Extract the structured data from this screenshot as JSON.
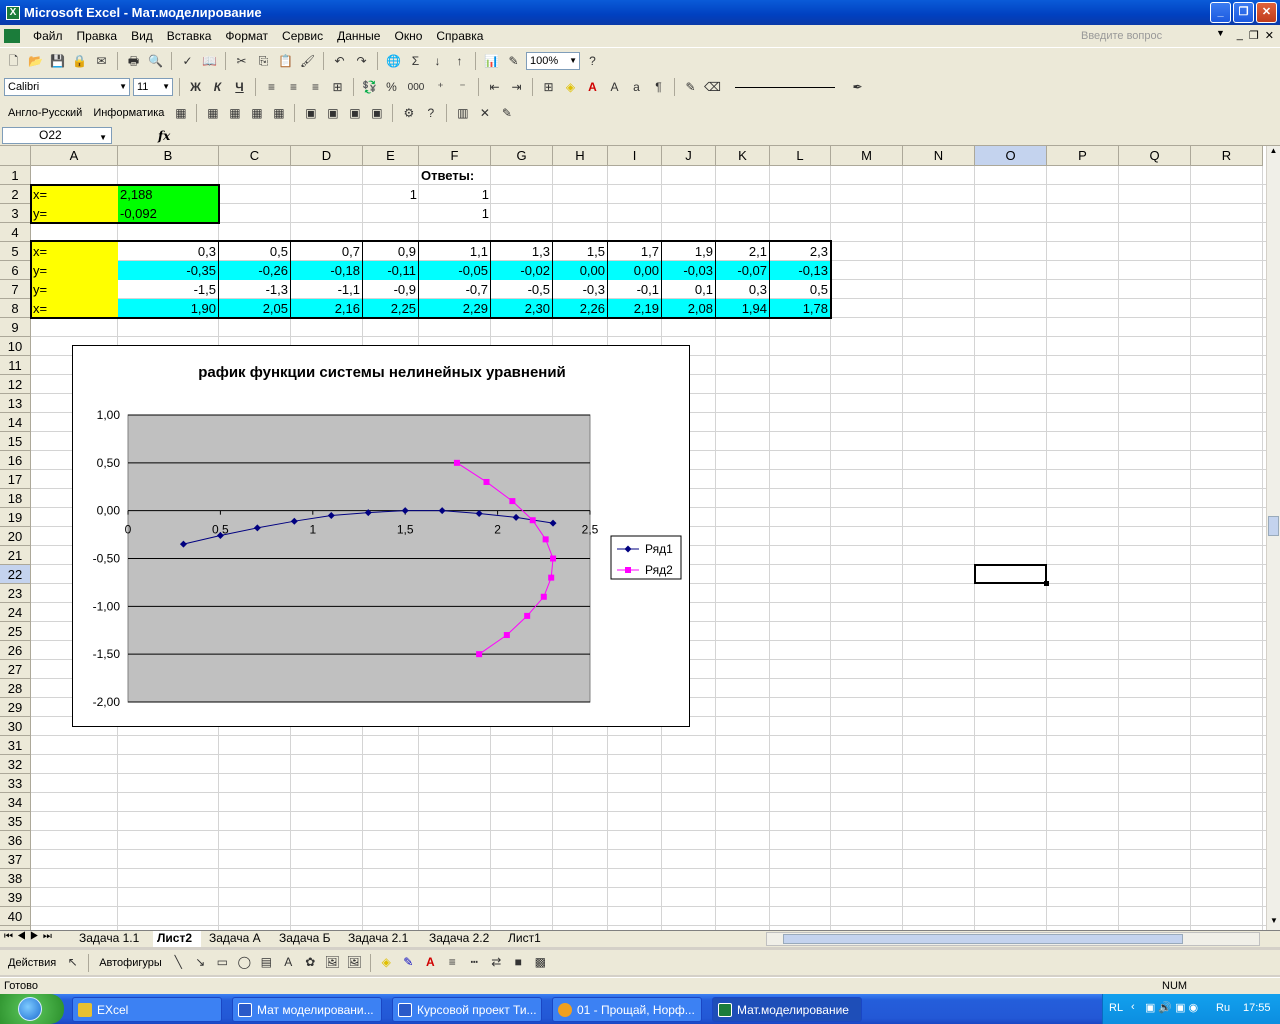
{
  "window": {
    "title": "Microsoft Excel - Мат.моделирование"
  },
  "menu": {
    "items": [
      "Файл",
      "Правка",
      "Вид",
      "Вставка",
      "Формат",
      "Сервис",
      "Данные",
      "Окно",
      "Справка"
    ],
    "help_placeholder": "Введите вопрос"
  },
  "toolbar": {
    "zoom": "100%",
    "font": "Calibri",
    "size": "11",
    "bold": "Ж",
    "italic": "К",
    "underline": "Ч",
    "thousands": "000",
    "percent": "%"
  },
  "toolbar3": {
    "translate": "Англо-Русский",
    "informatics": "Информатика"
  },
  "formula": {
    "namebox": "O22",
    "fx": "fx",
    "value": ""
  },
  "columns": [
    "A",
    "B",
    "C",
    "D",
    "E",
    "F",
    "G",
    "H",
    "I",
    "J",
    "K",
    "L",
    "M",
    "N",
    "O",
    "P",
    "Q",
    "R"
  ],
  "cells": {
    "F1": "Ответы:",
    "A2": "x=",
    "B2": "2,188",
    "E2": "1",
    "F2": "1",
    "A3": "y=",
    "B3": "-0,092",
    "F3": "1",
    "A5": "x=",
    "A6": "y=",
    "A7": "y=",
    "A8": "x=",
    "row5": [
      "0,3",
      "0,5",
      "0,7",
      "0,9",
      "1,1",
      "1,3",
      "1,5",
      "1,7",
      "1,9",
      "2,1",
      "2,3"
    ],
    "row6": [
      "-0,35",
      "-0,26",
      "-0,18",
      "-0,11",
      "-0,05",
      "-0,02",
      "0,00",
      "0,00",
      "-0,03",
      "-0,07",
      "-0,13"
    ],
    "row7": [
      "-1,5",
      "-1,3",
      "-1,1",
      "-0,9",
      "-0,7",
      "-0,5",
      "-0,3",
      "-0,1",
      "0,1",
      "0,3",
      "0,5"
    ],
    "row8": [
      "1,90",
      "2,05",
      "2,16",
      "2,25",
      "2,29",
      "2,30",
      "2,26",
      "2,19",
      "2,08",
      "1,94",
      "1,78"
    ]
  },
  "chart_data": {
    "type": "scatter",
    "title": "рафик функции системы нелинейных уравнений",
    "xlim": [
      0,
      2.5
    ],
    "ylim": [
      -2,
      1
    ],
    "x_ticks": [
      "0",
      "0,5",
      "1",
      "1,5",
      "2",
      "2,5"
    ],
    "y_ticks": [
      "1,00",
      "0,50",
      "0,00",
      "-0,50",
      "-1,00",
      "-1,50",
      "-2,00"
    ],
    "legend_position": "right",
    "series": [
      {
        "name": "Ряд1",
        "color": "#000080",
        "x": [
          0.3,
          0.5,
          0.7,
          0.9,
          1.1,
          1.3,
          1.5,
          1.7,
          1.9,
          2.1,
          2.3
        ],
        "y": [
          -0.35,
          -0.26,
          -0.18,
          -0.11,
          -0.05,
          -0.02,
          0.0,
          0.0,
          -0.03,
          -0.07,
          -0.13
        ]
      },
      {
        "name": "Ряд2",
        "color": "#ff00ff",
        "x": [
          1.9,
          2.05,
          2.16,
          2.25,
          2.29,
          2.3,
          2.26,
          2.19,
          2.08,
          1.94,
          1.78
        ],
        "y": [
          -1.5,
          -1.3,
          -1.1,
          -0.9,
          -0.7,
          -0.5,
          -0.3,
          -0.1,
          0.1,
          0.3,
          0.5
        ]
      }
    ]
  },
  "sheets": [
    "Задача 1.1",
    "Лист2",
    "Задача А",
    "Задача Б",
    "Задача 2.1",
    "Задача 2.2",
    "Лист1"
  ],
  "drawbar": {
    "actions": "Действия",
    "autoshapes": "Автофигуры"
  },
  "status": {
    "left": "Готово",
    "num": "NUM"
  },
  "taskbar": {
    "buttons": [
      "EXcel",
      "Мат моделировани...",
      "Курсовой проект Ти...",
      "01 - Прощай, Норф...",
      "Мат.моделирование"
    ],
    "lang": "RL",
    "ru": "Ru",
    "time": "17:55"
  }
}
